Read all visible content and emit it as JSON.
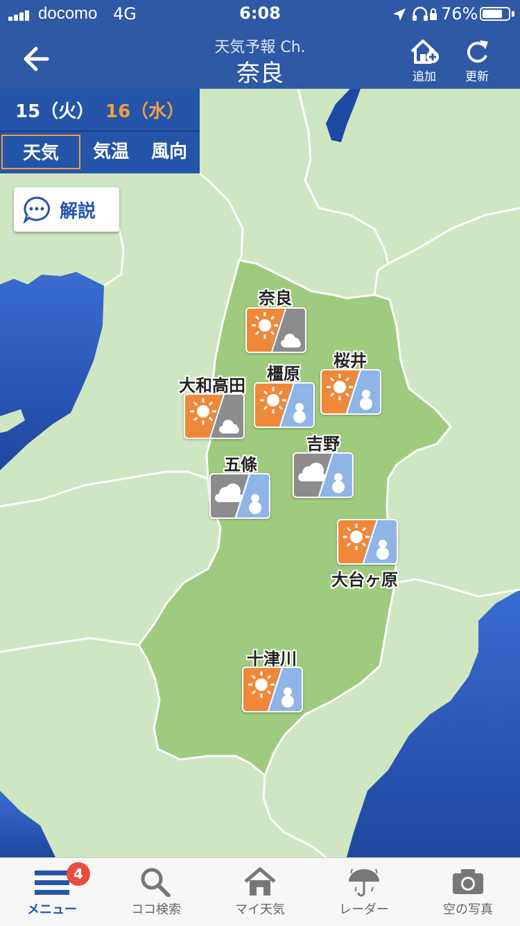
{
  "status": {
    "carrier": "docomo",
    "network": "4G",
    "time": "6:08",
    "battery": "76%"
  },
  "header": {
    "subtitle": "天気予報 Ch.",
    "title": "奈良",
    "add_label": "追加",
    "refresh_label": "更新"
  },
  "dates": [
    {
      "label": "15（火）",
      "color": "#ffffff"
    },
    {
      "label": "16（水）",
      "color": "#f0a040"
    }
  ],
  "tabs": [
    {
      "label": "天気",
      "active": true
    },
    {
      "label": "気温",
      "active": false
    },
    {
      "label": "風向",
      "active": false
    }
  ],
  "explain_button": {
    "label": "解説"
  },
  "locations": [
    {
      "name": "奈良",
      "weather": "sunny-then-cloudy"
    },
    {
      "name": "桜井",
      "weather": "sunny-then-snow"
    },
    {
      "name": "橿原",
      "weather": "sunny-then-snow"
    },
    {
      "name": "大和高田",
      "weather": "sunny-then-cloudy"
    },
    {
      "name": "吉野",
      "weather": "cloudy-then-snow"
    },
    {
      "name": "五條",
      "weather": "cloudy-then-snow"
    },
    {
      "name": "大台ヶ原",
      "weather": "sunny-then-snow"
    },
    {
      "name": "十津川",
      "weather": "sunny-then-snow"
    }
  ],
  "tabbar": {
    "items": [
      {
        "label": "メニュー",
        "icon": "menu-icon",
        "active": true,
        "badge": "4"
      },
      {
        "label": "ココ検索",
        "icon": "search-icon",
        "active": false
      },
      {
        "label": "マイ天気",
        "icon": "home-icon",
        "active": false
      },
      {
        "label": "レーダー",
        "icon": "umbrella-icon",
        "active": false
      },
      {
        "label": "空の写真",
        "icon": "camera-icon",
        "active": false
      }
    ]
  },
  "colors": {
    "accent": "#2f58a5",
    "sun": "#f0883a",
    "cloud": "#8c8c8c",
    "snow": "#8fb4e6",
    "nara": "#9fcb7e",
    "land": "#cfe6c2",
    "sea": "#2c59b5"
  }
}
